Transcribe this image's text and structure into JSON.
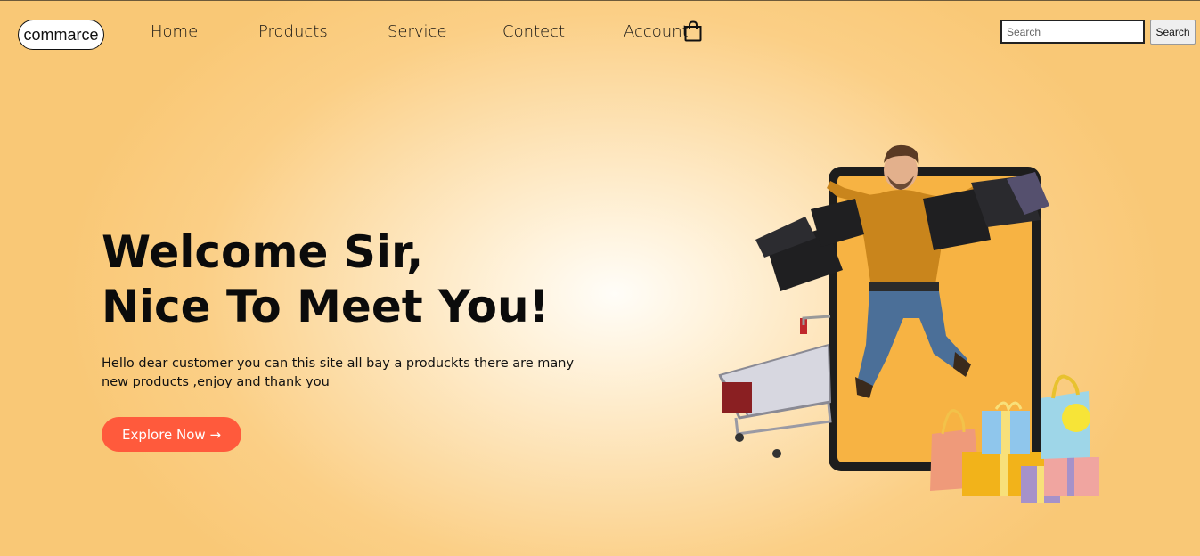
{
  "logo": {
    "text": "commarce"
  },
  "nav": {
    "links": [
      {
        "label": "Home"
      },
      {
        "label": "Products"
      },
      {
        "label": "Service"
      },
      {
        "label": "Contect"
      },
      {
        "label": "Account"
      }
    ],
    "cart_icon": "shopping-bag-icon"
  },
  "search": {
    "placeholder": "Search",
    "value": "",
    "button_label": "Search"
  },
  "hero": {
    "title_line1": "Welcome Sir,",
    "title_line2": "Nice To Meet You!",
    "text": "Hello dear customer you can this site all bay a produckts there are many new products ,enjoy and thank you",
    "cta_label": "Explore Now →"
  },
  "colors": {
    "accent": "#ff5a3c",
    "background_warm": "#f9c876"
  }
}
